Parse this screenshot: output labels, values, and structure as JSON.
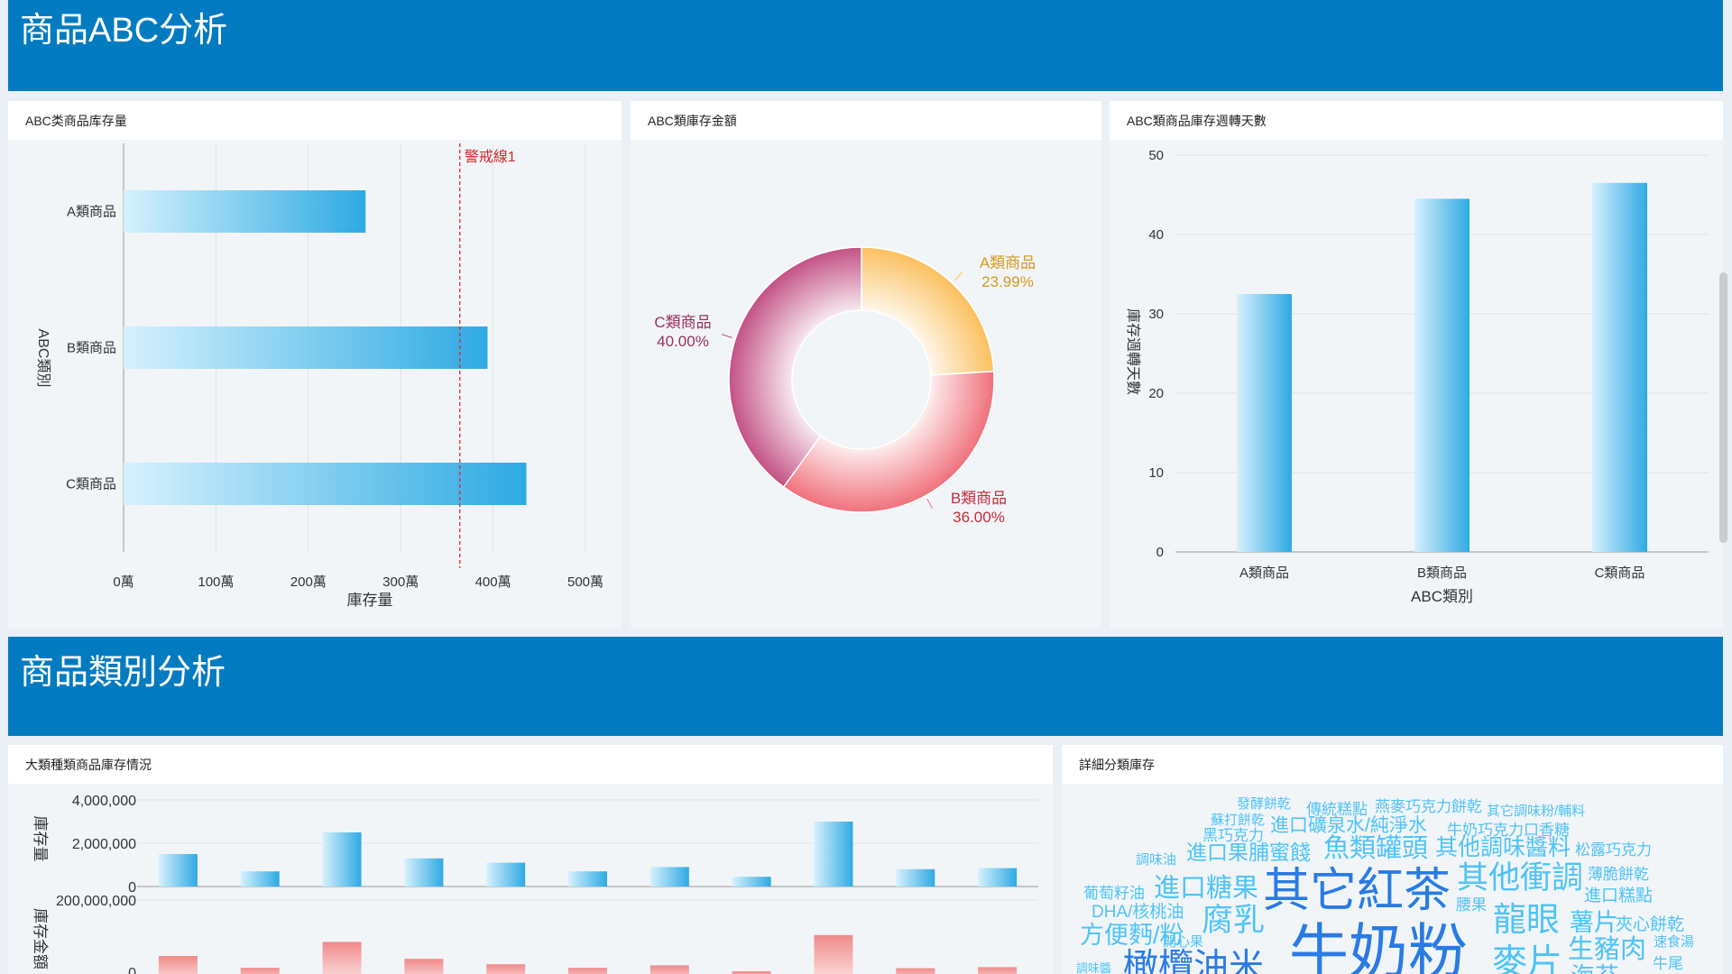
{
  "section_abc": {
    "title": "商品ABC分析"
  },
  "section_category": {
    "title": "商品類別分析"
  },
  "panels": {
    "stock_qty": "ABC类商品库存量",
    "stock_amount": "ABC類庫存金額",
    "turnover": "ABC類商品庫存週轉天數",
    "category_stock": "大類種類商品庫存情況",
    "detail_stock": "詳細分類庫存"
  },
  "colors": {
    "banner": "#027bc0",
    "bar_blue": "#2eaae3",
    "bar_red": "#f08a8a",
    "pie_a": "#fbbf5c",
    "pie_b": "#ef6f7a",
    "pie_c": "#c24f83",
    "warning": "#d9262c"
  },
  "chart_data": [
    {
      "type": "bar",
      "orientation": "horizontal",
      "categories": [
        "A類商品",
        "B類商品",
        "C類商品"
      ],
      "values": [
        2620000,
        3940000,
        4360000
      ],
      "xlabel": "庫存量",
      "ylabel": "ABC類別",
      "xlim": [
        0,
        5000000
      ],
      "ticks": [
        "0萬",
        "100萬",
        "200萬",
        "300萬",
        "400萬",
        "500萬"
      ],
      "markline": {
        "label": "警戒線1",
        "value": 3640000
      }
    },
    {
      "type": "pie",
      "donut": true,
      "slices": [
        {
          "label": "A類商品",
          "pct": "23.99%",
          "value": 23.99
        },
        {
          "label": "B類商品",
          "pct": "36.00%",
          "value": 36.0
        },
        {
          "label": "C類商品",
          "pct": "40.00%",
          "value": 40.0
        }
      ]
    },
    {
      "type": "bar",
      "categories": [
        "A類商品",
        "B類商品",
        "C類商品"
      ],
      "values": [
        32.5,
        44.5,
        46.5
      ],
      "xlabel": "ABC類別",
      "ylabel": "庫存週轉天數",
      "ylim": [
        0,
        50
      ],
      "ticks": [
        "0",
        "10",
        "20",
        "30",
        "40",
        "50"
      ]
    },
    {
      "type": "bar",
      "categories": [
        "",
        "",
        "",
        "",
        "",
        "",
        "",
        "",
        "",
        "",
        ""
      ],
      "series": [
        {
          "values": [
            1500000,
            700000,
            2500000,
            1300000,
            1100000,
            700000,
            900000,
            450000,
            3000000,
            800000,
            850000
          ]
        },
        {
          "values": [
            45000000,
            12000000,
            84000000,
            37000000,
            22000000,
            12000000,
            19000000,
            2500000,
            103000000,
            11000000,
            14000000
          ]
        }
      ],
      "top_ylabel": "庫存量",
      "top_ylim": [
        0,
        4000000
      ],
      "top_ticks": [
        "4,000,000",
        "2,000,000",
        "0"
      ],
      "bottom_ylabel": "庫存金額",
      "bottom_ticks": [
        "200,000,000",
        "0"
      ]
    }
  ],
  "wordcloud": [
    {
      "t": "發酵餅乾",
      "x": 1371,
      "y": 896,
      "s": 15,
      "c": "#4fc3f7"
    },
    {
      "t": "傳統糕點",
      "x": 1448,
      "y": 903,
      "s": 17,
      "c": "#4fc3f7"
    },
    {
      "t": "燕麥巧克力餅乾",
      "x": 1524,
      "y": 900,
      "s": 17,
      "c": "#4fc3f7"
    },
    {
      "t": "其它調味粉/輔料",
      "x": 1648,
      "y": 904,
      "s": 15,
      "c": "#4fc3f7"
    },
    {
      "t": "蘇打餅乾",
      "x": 1342,
      "y": 914,
      "s": 15,
      "c": "#4fc3f7"
    },
    {
      "t": "進口礦泉水/純淨水",
      "x": 1408,
      "y": 922,
      "s": 21,
      "c": "#4fc3f7"
    },
    {
      "t": "牛奶巧克力口香糖",
      "x": 1604,
      "y": 926,
      "s": 17,
      "c": "#4fc3f7"
    },
    {
      "t": "黑巧克力",
      "x": 1333,
      "y": 932,
      "s": 17,
      "c": "#4fc3f7"
    },
    {
      "t": "調味油",
      "x": 1259,
      "y": 958,
      "s": 15,
      "c": "#4fc3f7"
    },
    {
      "t": "進口果脯蜜餞",
      "x": 1315,
      "y": 953,
      "s": 23,
      "c": "#4fc3f7"
    },
    {
      "t": "魚類罐頭",
      "x": 1467,
      "y": 950,
      "s": 29,
      "c": "#4fc3f7"
    },
    {
      "t": "其他調味醬料",
      "x": 1591,
      "y": 948,
      "s": 25,
      "c": "#4fc3f7"
    },
    {
      "t": "松露巧克力",
      "x": 1746,
      "y": 948,
      "s": 17,
      "c": "#4fc3f7"
    },
    {
      "t": "葡萄籽油",
      "x": 1201,
      "y": 996,
      "s": 17,
      "c": "#4fc3f7"
    },
    {
      "t": "進口糖果",
      "x": 1279,
      "y": 994,
      "s": 29,
      "c": "#4fc3f7"
    },
    {
      "t": "其它紅茶",
      "x": 1400,
      "y": 1005,
      "s": 52,
      "c": "#2a7be4"
    },
    {
      "t": "其他衝調",
      "x": 1615,
      "y": 985,
      "s": 35,
      "c": "#4fc3f7"
    },
    {
      "t": "薄脆餅乾",
      "x": 1760,
      "y": 975,
      "s": 17,
      "c": "#4fc3f7"
    },
    {
      "t": "進口糕點",
      "x": 1756,
      "y": 999,
      "s": 19,
      "c": "#4fc3f7"
    },
    {
      "t": "DHA/核桃油",
      "x": 1210,
      "y": 1017,
      "s": 19,
      "c": "#4fc3f7"
    },
    {
      "t": "腰果",
      "x": 1614,
      "y": 1009,
      "s": 17,
      "c": "#4fc3f7"
    },
    {
      "t": "腐乳",
      "x": 1332,
      "y": 1032,
      "s": 35,
      "c": "#4fc3f7"
    },
    {
      "t": "龍眼",
      "x": 1655,
      "y": 1032,
      "s": 37,
      "c": "#4fc3f7"
    },
    {
      "t": "薯片",
      "x": 1740,
      "y": 1032,
      "s": 27,
      "c": "#4fc3f7"
    },
    {
      "t": "夾心餅乾",
      "x": 1791,
      "y": 1031,
      "s": 19,
      "c": "#4fc3f7"
    },
    {
      "t": "方便麪/粉",
      "x": 1197,
      "y": 1046,
      "s": 27,
      "c": "#4fc3f7"
    },
    {
      "t": "開心果",
      "x": 1289,
      "y": 1049,
      "s": 15,
      "c": "#4fc3f7"
    },
    {
      "t": "速食湯",
      "x": 1833,
      "y": 1049,
      "s": 15,
      "c": "#4fc3f7"
    },
    {
      "t": "牛奶粉",
      "x": 1429,
      "y": 1078,
      "s": 66,
      "c": "#2a7be4"
    },
    {
      "t": "生豬肉",
      "x": 1738,
      "y": 1062,
      "s": 29,
      "c": "#4fc3f7"
    },
    {
      "t": "橄欖油米",
      "x": 1245,
      "y": 1085,
      "s": 39,
      "c": "#2a7be4"
    },
    {
      "t": "麥片",
      "x": 1654,
      "y": 1080,
      "s": 39,
      "c": "#4fc3f7"
    },
    {
      "t": "海苔",
      "x": 1741,
      "y": 1092,
      "s": 27,
      "c": "#4fc3f7"
    },
    {
      "t": "牛尾",
      "x": 1832,
      "y": 1074,
      "s": 17,
      "c": "#4fc3f7"
    },
    {
      "t": "調味醬",
      "x": 1193,
      "y": 1078,
      "s": 13,
      "c": "#4fc3f7"
    }
  ]
}
